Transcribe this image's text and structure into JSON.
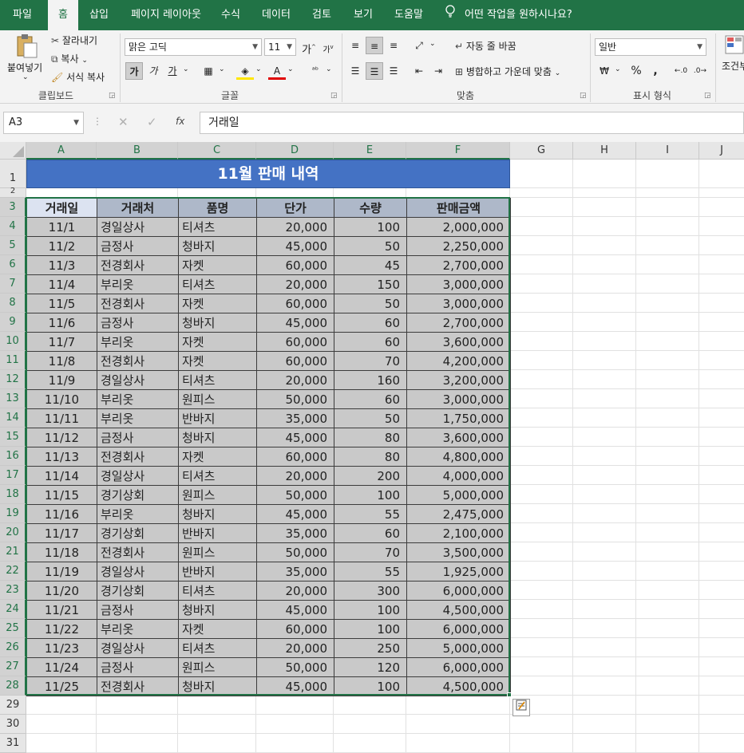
{
  "menu": {
    "tabs": [
      "파일",
      "홈",
      "삽입",
      "페이지 레이아웃",
      "수식",
      "데이터",
      "검토",
      "보기",
      "도움말"
    ],
    "active": "홈",
    "tell_me": "어떤 작업을 원하시나요?"
  },
  "ribbon": {
    "clipboard": {
      "paste": "붙여넣기",
      "cut": "잘라내기",
      "copy": "복사",
      "format_painter": "서식 복사",
      "label": "클립보드"
    },
    "font": {
      "name": "맑은 고딕",
      "size": "11",
      "bold": "가",
      "italic": "가",
      "underline": "가",
      "increase": "가",
      "decrease": "가",
      "label": "글꼴"
    },
    "alignment": {
      "wrap": "자동 줄 바꿈",
      "merge": "병합하고 가운데 맞춤",
      "label": "맞춤"
    },
    "number": {
      "format": "일반",
      "percent": "%",
      "comma": ",",
      "label": "표시 형식"
    },
    "styles": {
      "conditional": "조건부 서식"
    }
  },
  "formula_bar": {
    "name_box": "A3",
    "content": "거래일",
    "fx": "fx"
  },
  "columns": [
    "A",
    "B",
    "C",
    "D",
    "E",
    "F",
    "G",
    "H",
    "I",
    "J"
  ],
  "rows": [
    "1",
    "2",
    "3",
    "4",
    "5",
    "6",
    "7",
    "8",
    "9",
    "10",
    "11",
    "12",
    "13",
    "14",
    "15",
    "16",
    "17",
    "18",
    "19",
    "20",
    "21",
    "22",
    "23",
    "24",
    "25",
    "26",
    "27",
    "28",
    "29",
    "30",
    "31"
  ],
  "sheet": {
    "title": "11월 판매 내역",
    "headers": [
      "거래일",
      "거래처",
      "품명",
      "단가",
      "수량",
      "판매금액"
    ],
    "records": [
      [
        "11/1",
        "경일상사",
        "티셔츠",
        "20,000",
        "100",
        "2,000,000"
      ],
      [
        "11/2",
        "금정사",
        "청바지",
        "45,000",
        "50",
        "2,250,000"
      ],
      [
        "11/3",
        "전경회사",
        "자켓",
        "60,000",
        "45",
        "2,700,000"
      ],
      [
        "11/4",
        "부리옷",
        "티셔츠",
        "20,000",
        "150",
        "3,000,000"
      ],
      [
        "11/5",
        "전경회사",
        "자켓",
        "60,000",
        "50",
        "3,000,000"
      ],
      [
        "11/6",
        "금정사",
        "청바지",
        "45,000",
        "60",
        "2,700,000"
      ],
      [
        "11/7",
        "부리옷",
        "자켓",
        "60,000",
        "60",
        "3,600,000"
      ],
      [
        "11/8",
        "전경회사",
        "자켓",
        "60,000",
        "70",
        "4,200,000"
      ],
      [
        "11/9",
        "경일상사",
        "티셔츠",
        "20,000",
        "160",
        "3,200,000"
      ],
      [
        "11/10",
        "부리옷",
        "원피스",
        "50,000",
        "60",
        "3,000,000"
      ],
      [
        "11/11",
        "부리옷",
        "반바지",
        "35,000",
        "50",
        "1,750,000"
      ],
      [
        "11/12",
        "금정사",
        "청바지",
        "45,000",
        "80",
        "3,600,000"
      ],
      [
        "11/13",
        "전경회사",
        "자켓",
        "60,000",
        "80",
        "4,800,000"
      ],
      [
        "11/14",
        "경일상사",
        "티셔츠",
        "20,000",
        "200",
        "4,000,000"
      ],
      [
        "11/15",
        "경기상회",
        "원피스",
        "50,000",
        "100",
        "5,000,000"
      ],
      [
        "11/16",
        "부리옷",
        "청바지",
        "45,000",
        "55",
        "2,475,000"
      ],
      [
        "11/17",
        "경기상회",
        "반바지",
        "35,000",
        "60",
        "2,100,000"
      ],
      [
        "11/18",
        "전경회사",
        "원피스",
        "50,000",
        "70",
        "3,500,000"
      ],
      [
        "11/19",
        "경일상사",
        "반바지",
        "35,000",
        "55",
        "1,925,000"
      ],
      [
        "11/20",
        "경기상회",
        "티셔츠",
        "20,000",
        "300",
        "6,000,000"
      ],
      [
        "11/21",
        "금정사",
        "청바지",
        "45,000",
        "100",
        "4,500,000"
      ],
      [
        "11/22",
        "부리옷",
        "자켓",
        "60,000",
        "100",
        "6,000,000"
      ],
      [
        "11/23",
        "경일상사",
        "티셔츠",
        "20,000",
        "250",
        "5,000,000"
      ],
      [
        "11/24",
        "금정사",
        "원피스",
        "50,000",
        "120",
        "6,000,000"
      ],
      [
        "11/25",
        "전경회사",
        "청바지",
        "45,000",
        "100",
        "4,500,000"
      ]
    ]
  },
  "colors": {
    "ribbon_green": "#217346",
    "title_fill": "#4472c4",
    "header_fill": "#aeb8c9",
    "cell_fill": "#c9c9c9"
  }
}
